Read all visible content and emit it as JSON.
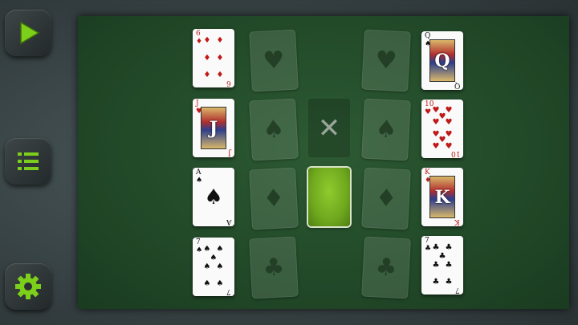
{
  "sidebar": {
    "buttons": [
      {
        "name": "play-button",
        "icon": "play-icon"
      },
      {
        "name": "menu-button",
        "icon": "list-icon"
      },
      {
        "name": "settings-button",
        "icon": "gear-icon"
      }
    ],
    "accent_color": "#7ccf1a"
  },
  "board": {
    "felt_color": "#224a29",
    "left_column": [
      {
        "rank": "6",
        "suit": "♦",
        "color": "red"
      },
      {
        "rank": "J",
        "suit": "♥",
        "color": "red"
      },
      {
        "rank": "A",
        "suit": "♠",
        "color": "black"
      },
      {
        "rank": "7",
        "suit": "♠",
        "color": "black"
      }
    ],
    "right_column": [
      {
        "rank": "Q",
        "suit": "♠",
        "color": "black"
      },
      {
        "rank": "10",
        "suit": "♥",
        "color": "red"
      },
      {
        "rank": "K",
        "suit": "♦",
        "color": "red"
      },
      {
        "rank": "7",
        "suit": "♣",
        "color": "black"
      }
    ],
    "ghost_left": [
      "♥",
      "♠",
      "♦",
      "♣"
    ],
    "ghost_right": [
      "♥",
      "♠",
      "♦",
      "♣"
    ],
    "discard_symbol": "✕",
    "deck_color": "#7ab526"
  }
}
